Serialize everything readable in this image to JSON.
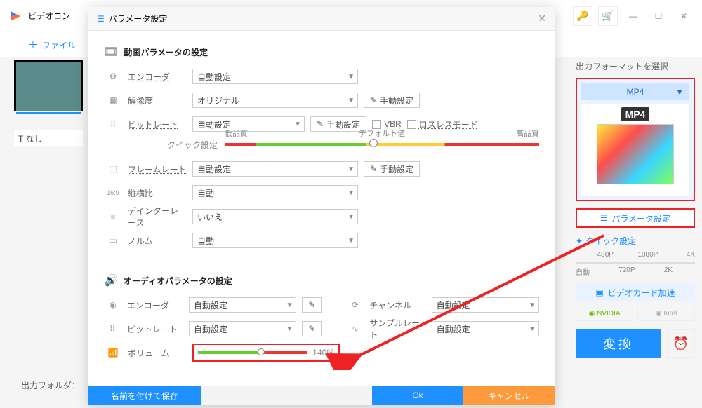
{
  "app": {
    "title": "ビデオコン"
  },
  "toolbar": {
    "file": "ファイル"
  },
  "left": {
    "none_label": "T なし"
  },
  "bottom": {
    "output_folder": "出力フォルダ："
  },
  "dialog": {
    "title": "パラメータ設定",
    "video_section": "動画パラメータの設定",
    "audio_section": "オーディオパラメータの設定",
    "labels": {
      "encoder": "エンコーダ",
      "resolution": "解像度",
      "bitrate": "ビットレート",
      "framerate": "フレームレート",
      "aspect": "縦横比",
      "deinterlace": "デインターレース",
      "norm": "ノルム",
      "channel": "チャンネル",
      "samplerate": "サンプルレート",
      "volume": "ボリューム",
      "quick_set": "クイック設定"
    },
    "values": {
      "auto": "自動設定",
      "original": "オリジナル",
      "auto_short": "自動",
      "no": "いいえ",
      "manual_btn": "手動設定",
      "vbr": "VBR",
      "lossless": "ロスレスモード",
      "low": "低品質",
      "default": "デフォルト値",
      "high": "高品質",
      "volume_pct": "140%"
    },
    "footer": {
      "save_as": "名前を付けて保存",
      "ok": "Ok",
      "cancel": "キャンセル"
    }
  },
  "sidebar": {
    "head": "出力フォーマットを選択",
    "format": "MP4",
    "thumb_tag": "MP4",
    "param_btn": "パラメータ設定",
    "quick_head": "クイック設定",
    "scale": {
      "p480": "480P",
      "p720": "720P",
      "p1080": "1080P",
      "p2k": "2K",
      "p4k": "4K",
      "auto": "自動"
    },
    "gpu_btn": "ビデオカード加速",
    "nvidia": "NVIDIA",
    "intel": "Intel",
    "convert": "変換"
  }
}
